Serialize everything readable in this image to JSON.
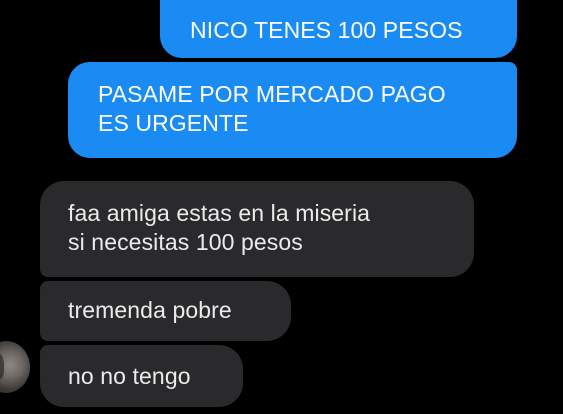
{
  "colors": {
    "background": "#000000",
    "sent_bubble": "#1a8bf2",
    "received_bubble": "#2a2a2c",
    "sent_text": "#ffffff",
    "received_text": "#ecebec"
  },
  "messages": [
    {
      "direction": "sent",
      "lines": [
        "NICO TENES 100 PESOS"
      ]
    },
    {
      "direction": "sent",
      "lines": [
        "PASAME POR MERCADO PAGO",
        "ES URGENTE"
      ]
    },
    {
      "direction": "received",
      "lines": [
        "faa amiga estas en la miseria",
        "si necesitas 100 pesos"
      ]
    },
    {
      "direction": "received",
      "lines": [
        "tremenda pobre"
      ]
    },
    {
      "direction": "received",
      "lines": [
        "no no tengo"
      ]
    }
  ],
  "contact": {
    "avatar_icon": "contact-avatar-photo"
  }
}
